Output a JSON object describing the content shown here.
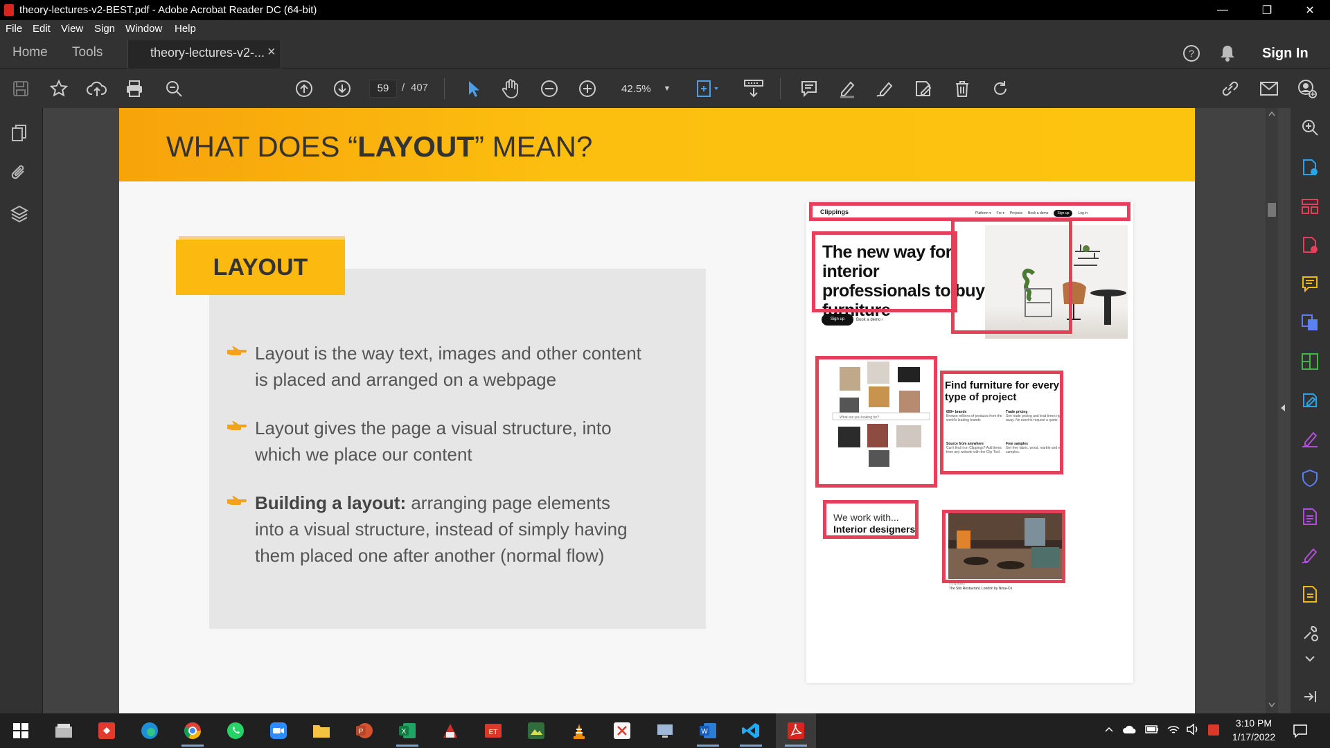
{
  "window": {
    "title": "theory-lectures-v2-BEST.pdf - Adobe Acrobat Reader DC (64-bit)",
    "minimize": "—",
    "restore": "❐",
    "close": "✕"
  },
  "menu": [
    "File",
    "Edit",
    "View",
    "Sign",
    "Window",
    "Help"
  ],
  "tabs": {
    "home": "Home",
    "tools": "Tools",
    "doc": "theory-lectures-v2-...",
    "doc_close": "×",
    "sign_in": "Sign In"
  },
  "toolbar": {
    "page_current": "59",
    "page_sep": "/",
    "page_total": "407",
    "zoom": "42.5%"
  },
  "slide": {
    "title_pre": "WHAT DOES “",
    "title_bold": "LAYOUT",
    "title_post": "” MEAN?",
    "label": "LAYOUT",
    "bullets": [
      {
        "bold": "",
        "text": "Layout is the way text, images and other content is placed and arranged on a webpage"
      },
      {
        "bold": "",
        "text": "Layout gives the page a visual structure, into which we place our content"
      },
      {
        "bold": "Building a layout:",
        "text": " arranging page elements into a visual structure, instead of simply having them placed one after another (normal flow)"
      }
    ]
  },
  "mockup": {
    "brand": "Clippings",
    "nav": [
      "Platform ▾",
      "For ▾",
      "Projects",
      "Book a demo",
      "Sign up",
      "Log in"
    ],
    "hero_title": "The new way for interior professionals to buy furniture",
    "hero_signup": "Sign up",
    "hero_demo": "Book a demo ›",
    "search_placeholder": "What are you looking for?",
    "features_title": "Find furniture for every type of project",
    "features": [
      {
        "title": "650+ brands",
        "desc": "Browse millions of products from the world's leading brands"
      },
      {
        "title": "Trade pricing",
        "desc": "See trade pricing and lead times right away. No need to request a quote."
      },
      {
        "title": "Source from anywhere",
        "desc": "Can't find it on Clippings? Add items from any website with the Clip Tool."
      },
      {
        "title": "Free samples",
        "desc": "Get free fabric, wood, marble and rug samples."
      }
    ],
    "work_with_1": "We work with...",
    "work_with_2": "Interior designers",
    "restaurant_tag": "Hospitality",
    "restaurant_caption": "The Silo Restaurant, London by Nina+Co"
  },
  "taskbar": {
    "time": "3:10 PM",
    "date": "1/17/2022"
  },
  "colors": {
    "accent_yellow": "#fcbe0f",
    "highlight_red": "#e4405a",
    "acrobat_red": "#d7261e",
    "selection_blue": "#4a9fe8"
  },
  "icons": {
    "toolbar": [
      "save-icon",
      "bookmark-star-icon",
      "upload-cloud-icon",
      "print-icon",
      "find-zoom-icon",
      "page-up-icon",
      "page-down-icon",
      "select-cursor-icon",
      "hand-pan-icon",
      "zoom-out-icon",
      "zoom-in-icon",
      "fit-page-icon",
      "scroll-mode-icon",
      "comment-icon",
      "highlight-pen-icon",
      "fill-sign-icon",
      "edit-pdf-icon",
      "delete-icon",
      "rotate-icon",
      "share-link-icon",
      "email-icon",
      "share-user-icon"
    ],
    "left_panel": [
      "page-thumbnails-icon",
      "attachments-icon",
      "layers-icon"
    ],
    "right_panel": [
      "search-zoom-icon",
      "export-pdf-icon",
      "organize-pages-icon",
      "create-pdf-icon",
      "comment-tool-icon",
      "combine-files-icon",
      "compress-pdf-icon",
      "edit-tool-icon",
      "fill-sign-tool-icon",
      "protect-icon",
      "pdf-standards-icon",
      "request-signature-icon",
      "send-review-icon",
      "more-tools-icon",
      "collapse-panel-icon"
    ]
  }
}
